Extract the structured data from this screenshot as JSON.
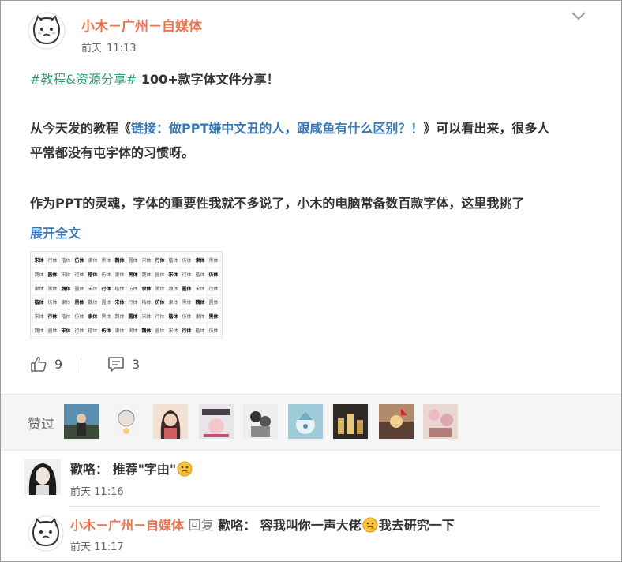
{
  "post": {
    "author": "小木－广州－自媒体",
    "time_day": "前天",
    "time_clock": "11:13",
    "line1_tag": "#教程&资源分享#",
    "line1_rest": " 100+款字体文件分享！",
    "line2_prefix": "从今天发的教程《",
    "line2_link": "链接：做PPT嫌中文丑的人，跟咸鱼有什么区别？！",
    "line2_suffix": "》可以看出来，很多人",
    "line3": "平常都没有屯字体的习惯呀。",
    "line4": "作为PPT的灵魂，字体的重要性我就不多说了，小木的电脑常备数百款字体，这里我挑了",
    "expand": "展开全文",
    "likes": "9",
    "comments": "3"
  },
  "likes_section": {
    "label": "赞过",
    "avatar_count": 9
  },
  "comment1": {
    "author": "歡咯",
    "sep": "： ",
    "text": "推荐\"字由\"",
    "time_day": "前天",
    "time_clock": "11:16"
  },
  "comment2": {
    "author": "小木－广州－自媒体",
    "reply_word": "回复",
    "reply_to": "歡咯",
    "text_a": "： 容我叫你一声大佬",
    "text_b": "我去研究一下",
    "time_day": "前天",
    "time_clock": "11:17"
  },
  "colors": {
    "author": "#eb7350",
    "topic": "#2e9f77",
    "link": "#3778b5"
  },
  "icons": [
    "cat-avatar-icon",
    "chevron-down-icon",
    "thumbs-up-icon",
    "comment-icon",
    "thinking-emoji-icon"
  ]
}
